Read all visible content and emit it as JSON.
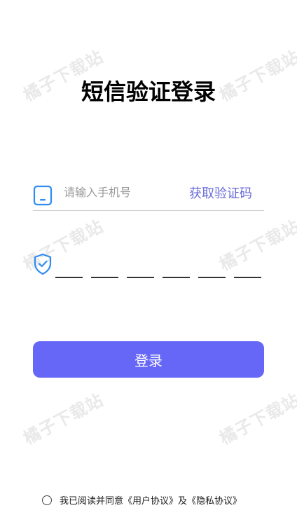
{
  "watermark": "橘子下载站",
  "page_title": "短信验证登录",
  "phone": {
    "placeholder": "请输入手机号",
    "value": "",
    "get_code_label": "获取验证码"
  },
  "verification": {
    "slot_count": 6
  },
  "login_button": {
    "label": "登录"
  },
  "agreement": {
    "prefix": "我已阅读并同意",
    "user_agreement": "《用户协议》",
    "conjunction": "及",
    "privacy_policy": "《隐私协议》"
  },
  "colors": {
    "accent": "#6667f7",
    "link": "#6a6bd9",
    "icon_blue": "#2f8cf0"
  },
  "icons": {
    "phone": "mobile-phone-icon",
    "verification": "shield-check-icon",
    "agreement_radio": "radio-circle-icon"
  }
}
